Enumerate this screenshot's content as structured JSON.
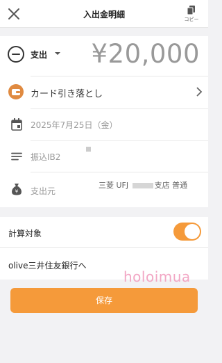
{
  "header": {
    "title": "入出金明細",
    "copy_label": "コピー"
  },
  "transaction": {
    "type_label": "支出",
    "amount": "¥20,000",
    "category": "カード引き落とし",
    "date": "2025年7月25日（金）",
    "memo": "振込IB2",
    "source_label": "支出元",
    "account_bank": "三菱 UFJ",
    "account_branch_suffix": "支店",
    "account_type": "普通"
  },
  "settings": {
    "calc_target_label": "計算対象",
    "calc_target_on": true,
    "note": "olive三井住友銀行へ"
  },
  "watermark": "holoimua",
  "actions": {
    "save_label": "保存"
  },
  "colors": {
    "accent": "#f59a3a",
    "category_icon": "#e08a40",
    "watermark": "#f2a6c4"
  }
}
